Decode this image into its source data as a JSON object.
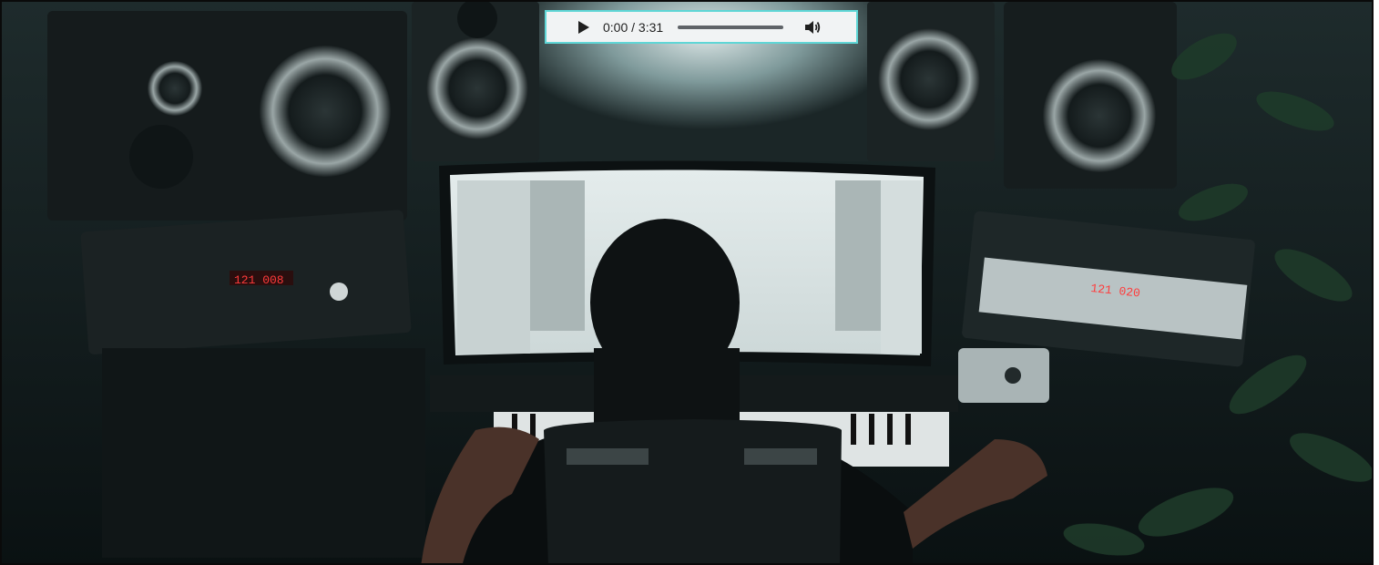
{
  "player": {
    "time_display": "0:00 / 3:31",
    "progress_fraction": 0,
    "icons": {
      "play": "play-icon",
      "volume": "volume-icon"
    },
    "accent_border_color": "#5fd6d6"
  },
  "scene": {
    "kind": "photo of a music production studio",
    "screen_readouts": {
      "left_unit": "121 008",
      "right_unit": "121 020"
    }
  }
}
